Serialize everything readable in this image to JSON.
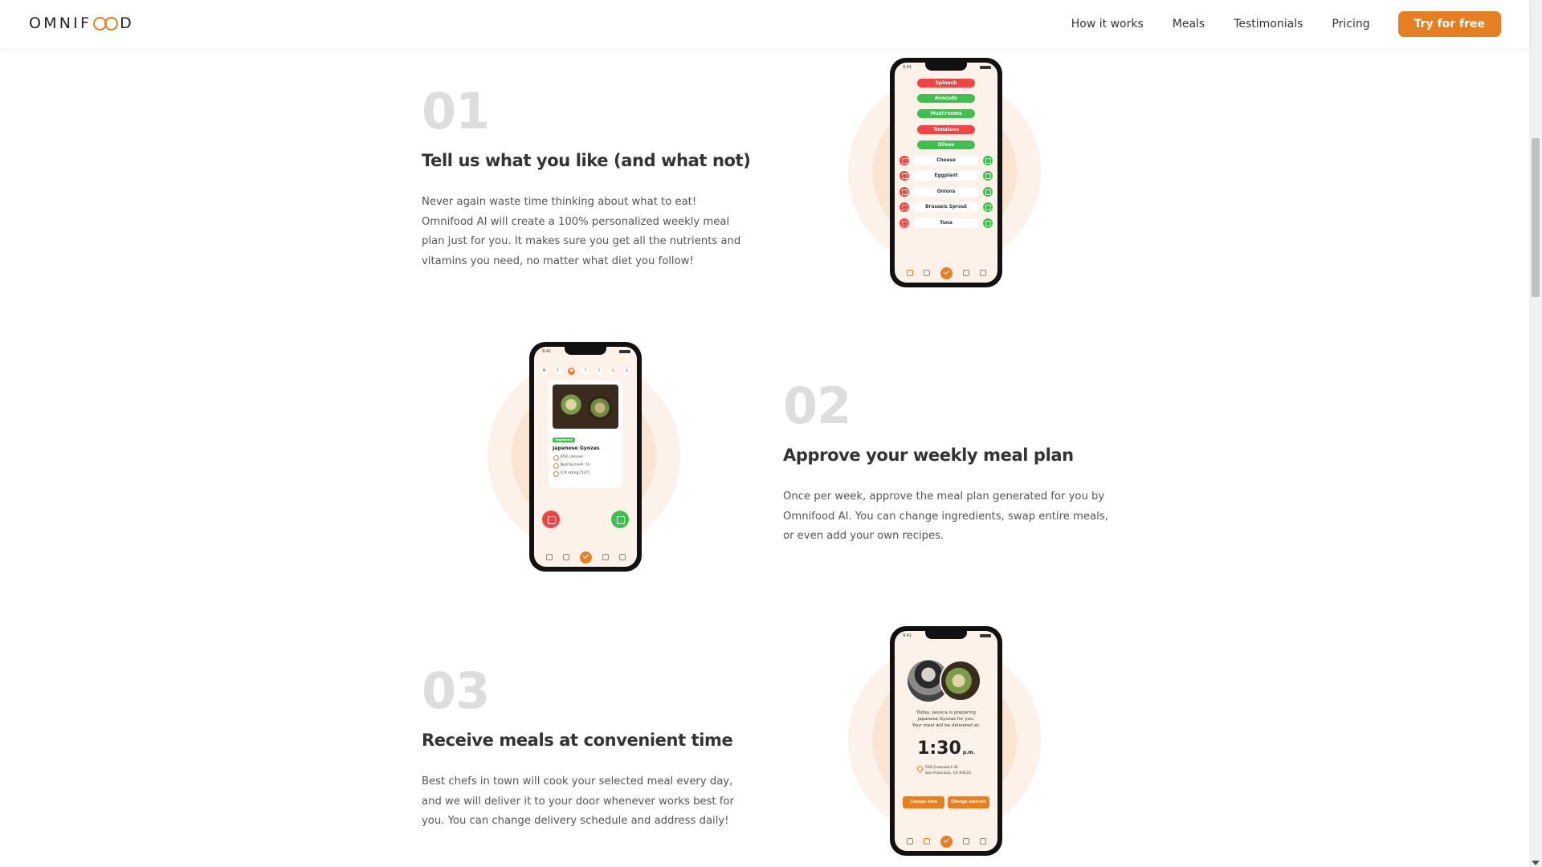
{
  "header": {
    "logo_prefix": "OMNIF",
    "logo_suffix": "D",
    "nav": [
      "How it works",
      "Meals",
      "Testimonials",
      "Pricing"
    ],
    "cta": "Try for free",
    "brand_color": "#e67e22"
  },
  "steps": [
    {
      "number": "01",
      "title": "Tell us what you like (and what not)",
      "description": "Never again waste time thinking about what to eat! Omnifood AI will create a 100% personalized weekly meal plan just for you. It makes sure you get all the nutrients and vitamins you need, no matter what diet you follow!"
    },
    {
      "number": "02",
      "title": "Approve your weekly meal plan",
      "description": "Once per week, approve the meal plan generated for you by Omnifood AI. You can change ingredients, swap entire meals, or even add your own recipes."
    },
    {
      "number": "03",
      "title": "Receive meals at convenient time",
      "description": "Best chefs in town will cook your selected meal every day, and we will deliver it to your door whenever works best for you. You can change delivery schedule and address daily!"
    }
  ],
  "phone1": {
    "status_time": "9:41",
    "pills": [
      {
        "label": "Spinach",
        "state": "red"
      },
      {
        "label": "Avocado",
        "state": "green"
      },
      {
        "label": "Mushrooms",
        "state": "green"
      },
      {
        "label": "Tomatoes",
        "state": "red"
      },
      {
        "label": "Olives",
        "state": "green"
      }
    ],
    "rows": [
      "Cheese",
      "Eggplant",
      "Onions",
      "Brussels Sprout",
      "Tuna"
    ]
  },
  "phone2": {
    "status_time": "9:41",
    "days": [
      "M",
      "T",
      "W",
      "T",
      "F",
      "S",
      "S"
    ],
    "tag": "Vegetarian",
    "meal_name": "Japanese Gyozas",
    "attrs": [
      "650 calories",
      "NutriScore® 74",
      "4.9 rating (537)"
    ]
  },
  "phone3": {
    "status_time": "9:41",
    "line1": "Today, Jessica is preparing",
    "line2": "Japanese Gyozas for you.",
    "line3": "Your meal will be delivered at:",
    "time": "1:30",
    "ampm": "p.m.",
    "addr1": "550 Greenwich St",
    "addr2": "San Francisco, CA 94133",
    "btn1": "Change time",
    "btn2": "Change address"
  }
}
